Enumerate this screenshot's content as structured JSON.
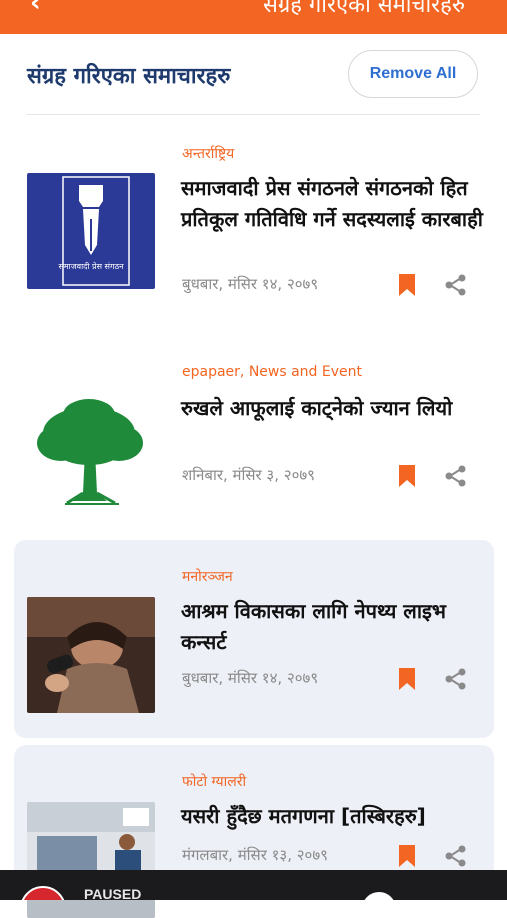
{
  "app_bar": {
    "title": "संग्रह गरिएका समाचारहरु",
    "back_icon": "back-arrow-icon",
    "color": "#f26522"
  },
  "header": {
    "title": "संग्रह गरिएका समाचारहरु",
    "remove_all": "Remove All"
  },
  "articles": [
    {
      "category": "अन्तर्राष्ट्रिय",
      "title": "समाजवादी प्रेस संगठनले संगठनको हित प्रतिकूल गतिविधि गर्ने सदस्यलाई कारबाही",
      "date": "बुधबार, मंसिर १४, २०७९",
      "thumb_text": "समाजवादी प्रेस संगठन",
      "highlighted": false
    },
    {
      "category": "epapaer, News and Event",
      "title": "रुखले आफूलाई काट्नेको ज्यान लियो",
      "date": "शनिबार, मंसिर ३, २०७९",
      "highlighted": false
    },
    {
      "category": "मनोरञ्जन",
      "title": "आश्रम विकासका लागि नेपथ्य लाइभ कन्सर्ट",
      "date": "बुधबार, मंसिर १४, २०७९",
      "highlighted": true
    },
    {
      "category": "फोटो ग्यालरी",
      "title": "यसरी हुँदैछ मतगणना [तस्बिरहरु]",
      "date": "मंगलबार, मंसिर १३, २०७९",
      "highlighted": true
    }
  ],
  "icons": {
    "bookmark": "bookmark-icon",
    "share": "share-icon"
  },
  "player": {
    "status": "PAUSED"
  }
}
